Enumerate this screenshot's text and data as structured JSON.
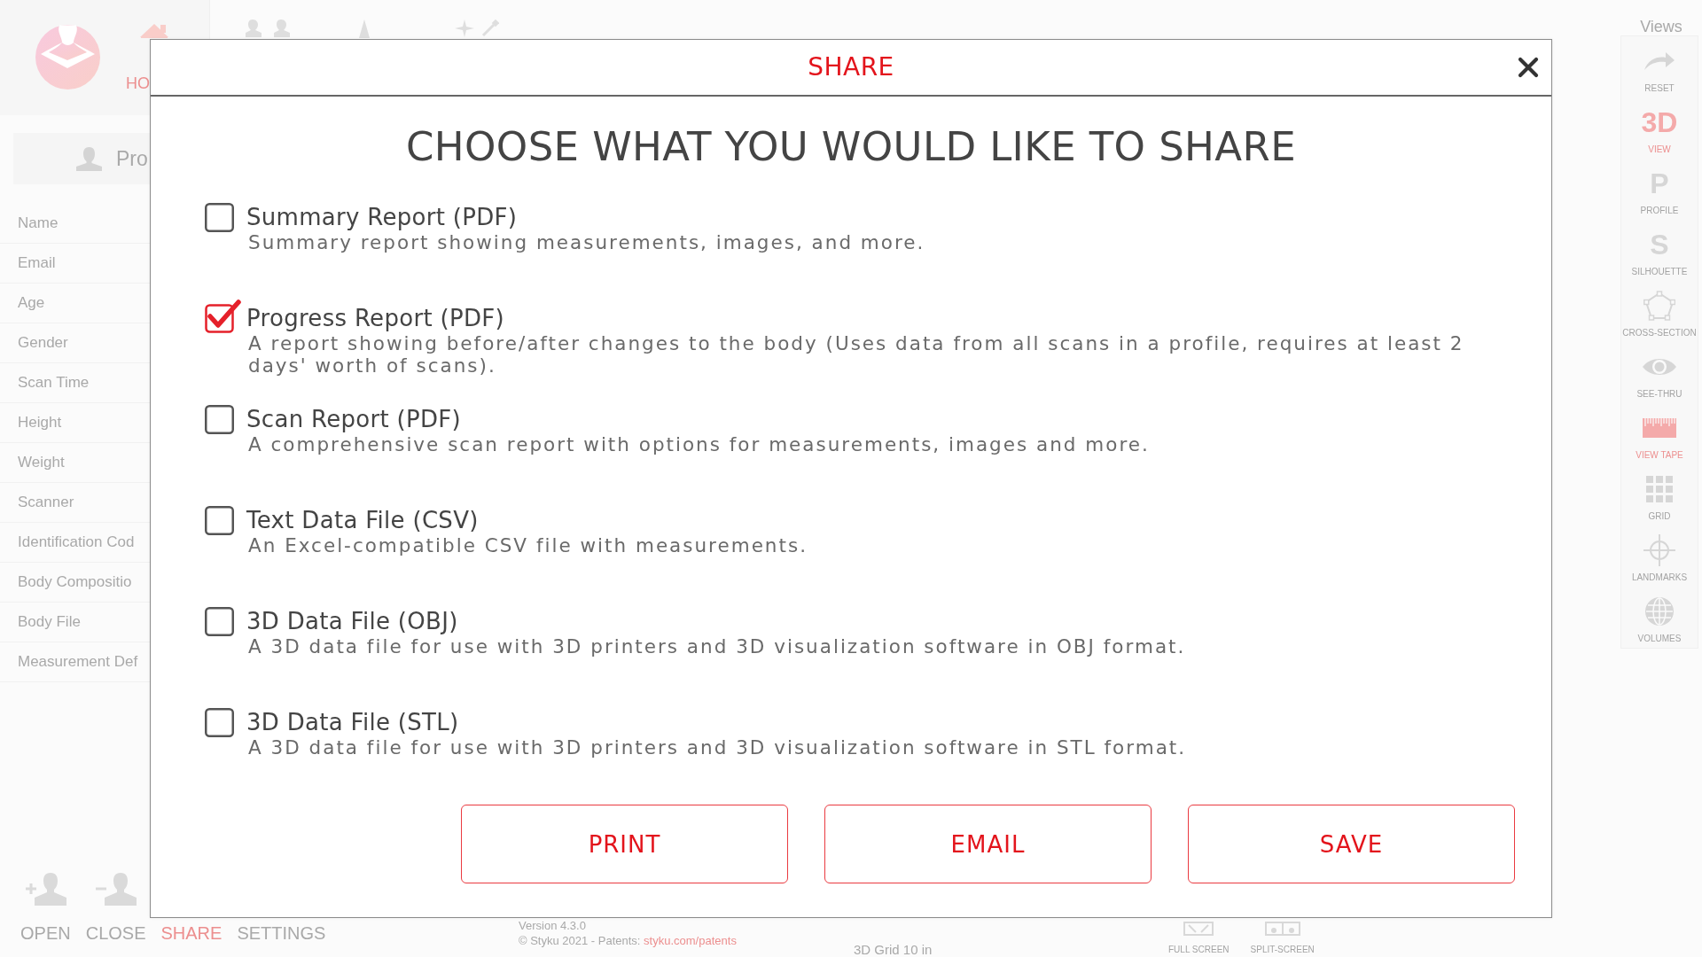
{
  "app": {
    "header": {
      "home_label": "HO"
    },
    "profile_button": {
      "label": "Pro"
    },
    "sidebar": {
      "items": [
        "Name",
        "Email",
        "Age",
        "Gender",
        "Scan Time",
        "Height",
        "Weight",
        "Scanner",
        "Identification Cod",
        "Body Compositio",
        "Body File",
        "Measurement Def"
      ]
    },
    "views_toolbar": {
      "title": "Views",
      "items": [
        {
          "kind": "arrow",
          "label": "RESET",
          "selected": false
        },
        {
          "kind": "glyph",
          "glyph": "3D",
          "label": "VIEW",
          "selected": true
        },
        {
          "kind": "glyph",
          "glyph": "P",
          "label": "PROFILE",
          "selected": false
        },
        {
          "kind": "glyph",
          "glyph": "S",
          "label": "SILHOUETTE",
          "selected": false
        },
        {
          "kind": "pentagon",
          "label": "CROSS-SECTION",
          "selected": false
        },
        {
          "kind": "eye",
          "label": "SEE-THRU",
          "selected": false
        },
        {
          "kind": "tape",
          "label": "VIEW TAPE",
          "selected": true
        },
        {
          "kind": "grid",
          "label": "GRID",
          "selected": false
        },
        {
          "kind": "crosshair",
          "label": "LANDMARKS",
          "selected": false
        },
        {
          "kind": "globe",
          "label": "VOLUMES",
          "selected": false
        }
      ]
    },
    "bottom_nav": {
      "items": [
        {
          "kind": "add-person",
          "label": "OPEN",
          "selected": false
        },
        {
          "kind": "remove-person",
          "label": "CLOSE",
          "selected": false
        },
        {
          "kind": "label",
          "label": "SHARE",
          "selected": true
        },
        {
          "kind": "label",
          "label": "SETTINGS",
          "selected": false
        }
      ]
    },
    "footer": {
      "version": "Version 4.3.0",
      "copyright": "© Styku 2021 - Patents:",
      "patents_link": "styku.com/patents"
    },
    "grid_label": "3D Grid 10 in",
    "screen_buttons": [
      {
        "kind": "full-screen",
        "label": "FULL SCREEN"
      },
      {
        "kind": "split-screen",
        "label": "SPLIT-SCREEN"
      }
    ]
  },
  "dialog": {
    "title": "SHARE",
    "heading": "CHOOSE WHAT YOU WOULD LIKE TO SHARE",
    "options": [
      {
        "title": "Summary Report (PDF)",
        "description": "Summary report showing measurements, images, and more.",
        "checked": false
      },
      {
        "title": "Progress Report (PDF)",
        "description": "A report showing before/after changes to the body (Uses data from all scans in a profile, requires at least 2 days' worth of scans).",
        "checked": true
      },
      {
        "title": "Scan Report (PDF)",
        "description": "A comprehensive scan report with options for measurements, images and more.",
        "checked": false
      },
      {
        "title": "Text Data File (CSV)",
        "description": "An Excel-compatible CSV file with measurements.",
        "checked": false
      },
      {
        "title": "3D Data File (OBJ)",
        "description": "A 3D data file for use with 3D printers and 3D visualization software in OBJ format.",
        "checked": false
      },
      {
        "title": "3D Data File (STL)",
        "description": "A 3D data file for use with 3D printers and 3D visualization software in STL format.",
        "checked": false
      }
    ],
    "buttons": [
      "PRINT",
      "EMAIL",
      "SAVE"
    ]
  }
}
